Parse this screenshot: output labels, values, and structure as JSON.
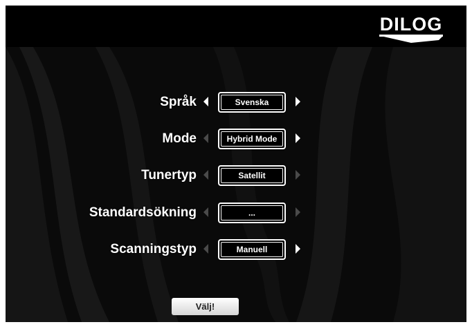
{
  "brand": {
    "logo_text": "DILOG"
  },
  "settings": [
    {
      "label": "Språk",
      "value": "Svenska",
      "left_active": true,
      "right_active": true
    },
    {
      "label": "Mode",
      "value": "Hybrid Mode",
      "left_active": false,
      "right_active": true
    },
    {
      "label": "Tunertyp",
      "value": "Satellit",
      "left_active": false,
      "right_active": false
    },
    {
      "label": "Standardsökning",
      "value": "...",
      "left_active": false,
      "right_active": false
    },
    {
      "label": "Scanningstyp",
      "value": "Manuell",
      "left_active": false,
      "right_active": true
    }
  ],
  "actions": {
    "select_label": "Välj!"
  },
  "colors": {
    "background": "#0a0a0a",
    "text": "#ffffff",
    "arrow_dim": "#4a4a4a",
    "button": "#e6e6e6"
  }
}
